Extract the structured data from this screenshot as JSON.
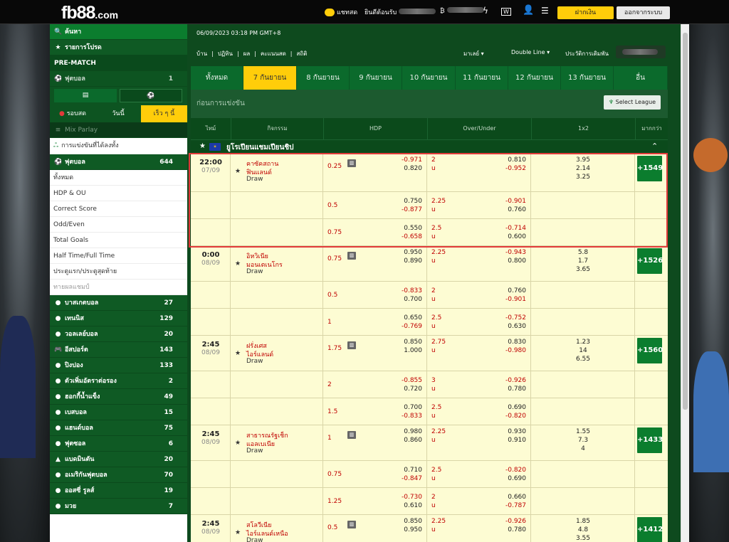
{
  "header": {
    "logo_main": "fb88",
    "logo_suffix": ".com",
    "live_label": "แชทสด",
    "welcome": "ยินดีต้อนรับ",
    "deposit": "ฝากเงิน",
    "logout": "ออกจากระบบ"
  },
  "sidebar": {
    "search": "ค้นหา",
    "favorites": "รายการโปรด",
    "prematch": "PRE-MATCH",
    "football_head": {
      "label": "ฟุตบอล",
      "count": "1"
    },
    "tabs": {
      "live": "รอบสด",
      "today": "วันนี้",
      "early": "เร็ว ๆ นี้"
    },
    "mix_parlay": "Mix Parlay",
    "comp": "การแข่งขันที่ได้ลงทั้ง",
    "football": {
      "label": "ฟุตบอล",
      "count": "644"
    },
    "markets": [
      "ทั้งหมด",
      "HDP & OU",
      "Correct Score",
      "Odd/Even",
      "Total Goals",
      "Half Time/Full Time",
      "ประตูแรก/ประตูสุดท้าย",
      "ทายผลแชมป์"
    ],
    "sports": [
      {
        "label": "บาสเกตบอล",
        "count": "27",
        "icon": "●"
      },
      {
        "label": "เทนนิส",
        "count": "129",
        "icon": "●"
      },
      {
        "label": "วอลเลย์บอล",
        "count": "20",
        "icon": "●"
      },
      {
        "label": "อีสปอร์ต",
        "count": "143",
        "icon": "🎮"
      },
      {
        "label": "ปิงปอง",
        "count": "133",
        "icon": "●"
      },
      {
        "label": "ตัวเพิ่มอัตราต่อรอง",
        "count": "2",
        "icon": "●"
      },
      {
        "label": "ฮอกกี้น้ำแข็ง",
        "count": "49",
        "icon": "●"
      },
      {
        "label": "เบสบอล",
        "count": "15",
        "icon": "●"
      },
      {
        "label": "แฮนด์บอล",
        "count": "75",
        "icon": "●"
      },
      {
        "label": "ฟุตซอล",
        "count": "6",
        "icon": "●"
      },
      {
        "label": "แบดมินตัน",
        "count": "20",
        "icon": "▲"
      },
      {
        "label": "อเมริกันฟุตบอล",
        "count": "70",
        "icon": "●"
      },
      {
        "label": "ออสซี่ รูลส์",
        "count": "19",
        "icon": "●"
      },
      {
        "label": "มวย",
        "count": "7",
        "icon": "●"
      }
    ]
  },
  "main": {
    "datetime": "06/09/2023 03:18 PM GMT+8",
    "nav": [
      "บ้าน",
      "ปฏิทิน",
      "ผล",
      "คะแนนสด",
      "สถิติ"
    ],
    "odds_type": "มาเลย์",
    "odds_mode": "Double Line",
    "history": "ประวัติการเดิมพัน",
    "date_tabs": [
      "ทั้งหมด",
      "7 กันยายน",
      "8 กันยายน",
      "9 กันยายน",
      "10 กันยายน",
      "11 กันยายน",
      "12 กันยายน",
      "13 กันยายน",
      "อื่น"
    ],
    "section": "ก่อนการแข่งขัน",
    "select_league": "Select League",
    "headers": [
      "ไทม์",
      "กิจกรรม",
      "HDP",
      "Over/Under",
      "1x2",
      "มากกว่า"
    ],
    "league": "ยูโรเปียนแชมเปียนชิป",
    "matches": [
      {
        "time": "22:00",
        "date": "07/09",
        "home": "คาซัคสถาน",
        "away": "ฟินแลนด์",
        "draw": "Draw",
        "more": "+1549",
        "rows": [
          {
            "hdp": "0.25",
            "ho": "-0.971",
            "ao": "0.820",
            "ou": "2",
            "u": "u",
            "oo": "0.810",
            "uo": "-0.952",
            "x": [
              "3.95",
              "2.14",
              "3.25"
            ]
          },
          {
            "hdp": "0.5",
            "ho": "0.750",
            "ao": "-0.877",
            "ou": "2.25",
            "u": "u",
            "oo": "-0.901",
            "uo": "0.760"
          },
          {
            "hdp": "0.75",
            "ho": "0.550",
            "ao": "-0.658",
            "ou": "2.5",
            "u": "u",
            "oo": "-0.714",
            "uo": "0.600"
          }
        ]
      },
      {
        "time": "0:00",
        "date": "08/09",
        "home": "อิหวิเนีย",
        "away": "มอนเตเนโกร",
        "draw": "Draw",
        "more": "+1526",
        "rows": [
          {
            "hdp": "0.75",
            "ho": "0.950",
            "ao": "0.890",
            "ou": "2.25",
            "u": "u",
            "oo": "-0.943",
            "uo": "0.800",
            "x": [
              "5.8",
              "1.7",
              "3.65"
            ]
          },
          {
            "hdp": "0.5",
            "ho": "-0.833",
            "ao": "0.700",
            "ou": "2",
            "u": "u",
            "oo": "0.760",
            "uo": "-0.901"
          },
          {
            "hdp": "1",
            "ho": "0.650",
            "ao": "-0.769",
            "ou": "2.5",
            "u": "u",
            "oo": "-0.752",
            "uo": "0.630"
          }
        ]
      },
      {
        "time": "2:45",
        "date": "08/09",
        "home": "ฝรั่งเศส",
        "away": "ไอร์แลนด์",
        "draw": "Draw",
        "more": "+1560",
        "rows": [
          {
            "hdp": "1.75",
            "ho": "0.850",
            "ao": "1.000",
            "ou": "2.75",
            "u": "u",
            "oo": "0.830",
            "uo": "-0.980",
            "x": [
              "1.23",
              "14",
              "6.55"
            ]
          },
          {
            "hdp": "2",
            "ho": "-0.855",
            "ao": "0.720",
            "ou": "3",
            "u": "u",
            "oo": "-0.926",
            "uo": "0.780"
          },
          {
            "hdp": "1.5",
            "ho": "0.700",
            "ao": "-0.833",
            "ou": "2.5",
            "u": "u",
            "oo": "0.690",
            "uo": "-0.820"
          }
        ]
      },
      {
        "time": "2:45",
        "date": "08/09",
        "home": "สาธารณรัฐเช็ก",
        "away": "แอลเบเนีย",
        "draw": "Draw",
        "more": "+1433",
        "rows": [
          {
            "hdp": "1",
            "ho": "0.980",
            "ao": "0.860",
            "ou": "2.25",
            "u": "u",
            "oo": "0.930",
            "uo": "0.910",
            "x": [
              "1.55",
              "7.3",
              "4"
            ]
          },
          {
            "hdp": "0.75",
            "ho": "0.710",
            "ao": "-0.847",
            "ou": "2.5",
            "u": "u",
            "oo": "-0.820",
            "uo": "0.690"
          },
          {
            "hdp": "1.25",
            "ho": "-0.730",
            "ao": "0.610",
            "ou": "2",
            "u": "u",
            "oo": "0.660",
            "uo": "-0.787"
          }
        ]
      },
      {
        "time": "2:45",
        "date": "08/09",
        "home": "สโลวีเนีย",
        "away": "ไอร์แลนด์เหนือ",
        "draw": "Draw",
        "more": "+1412",
        "rows": [
          {
            "hdp": "0.5",
            "ho": "0.850",
            "ao": "0.950",
            "ou": "2.25",
            "u": "u",
            "oo": "-0.926",
            "uo": "0.780",
            "x": [
              "1.85",
              "4.8",
              "3.55"
            ]
          }
        ]
      }
    ]
  },
  "colors": {
    "green_dark": "#0e4a1e",
    "green_tab": "#0b6a2c",
    "yellow": "#ffcd0a",
    "row": "#fdfcd3",
    "red": "#c00000",
    "highlight": "#e23a3a"
  }
}
